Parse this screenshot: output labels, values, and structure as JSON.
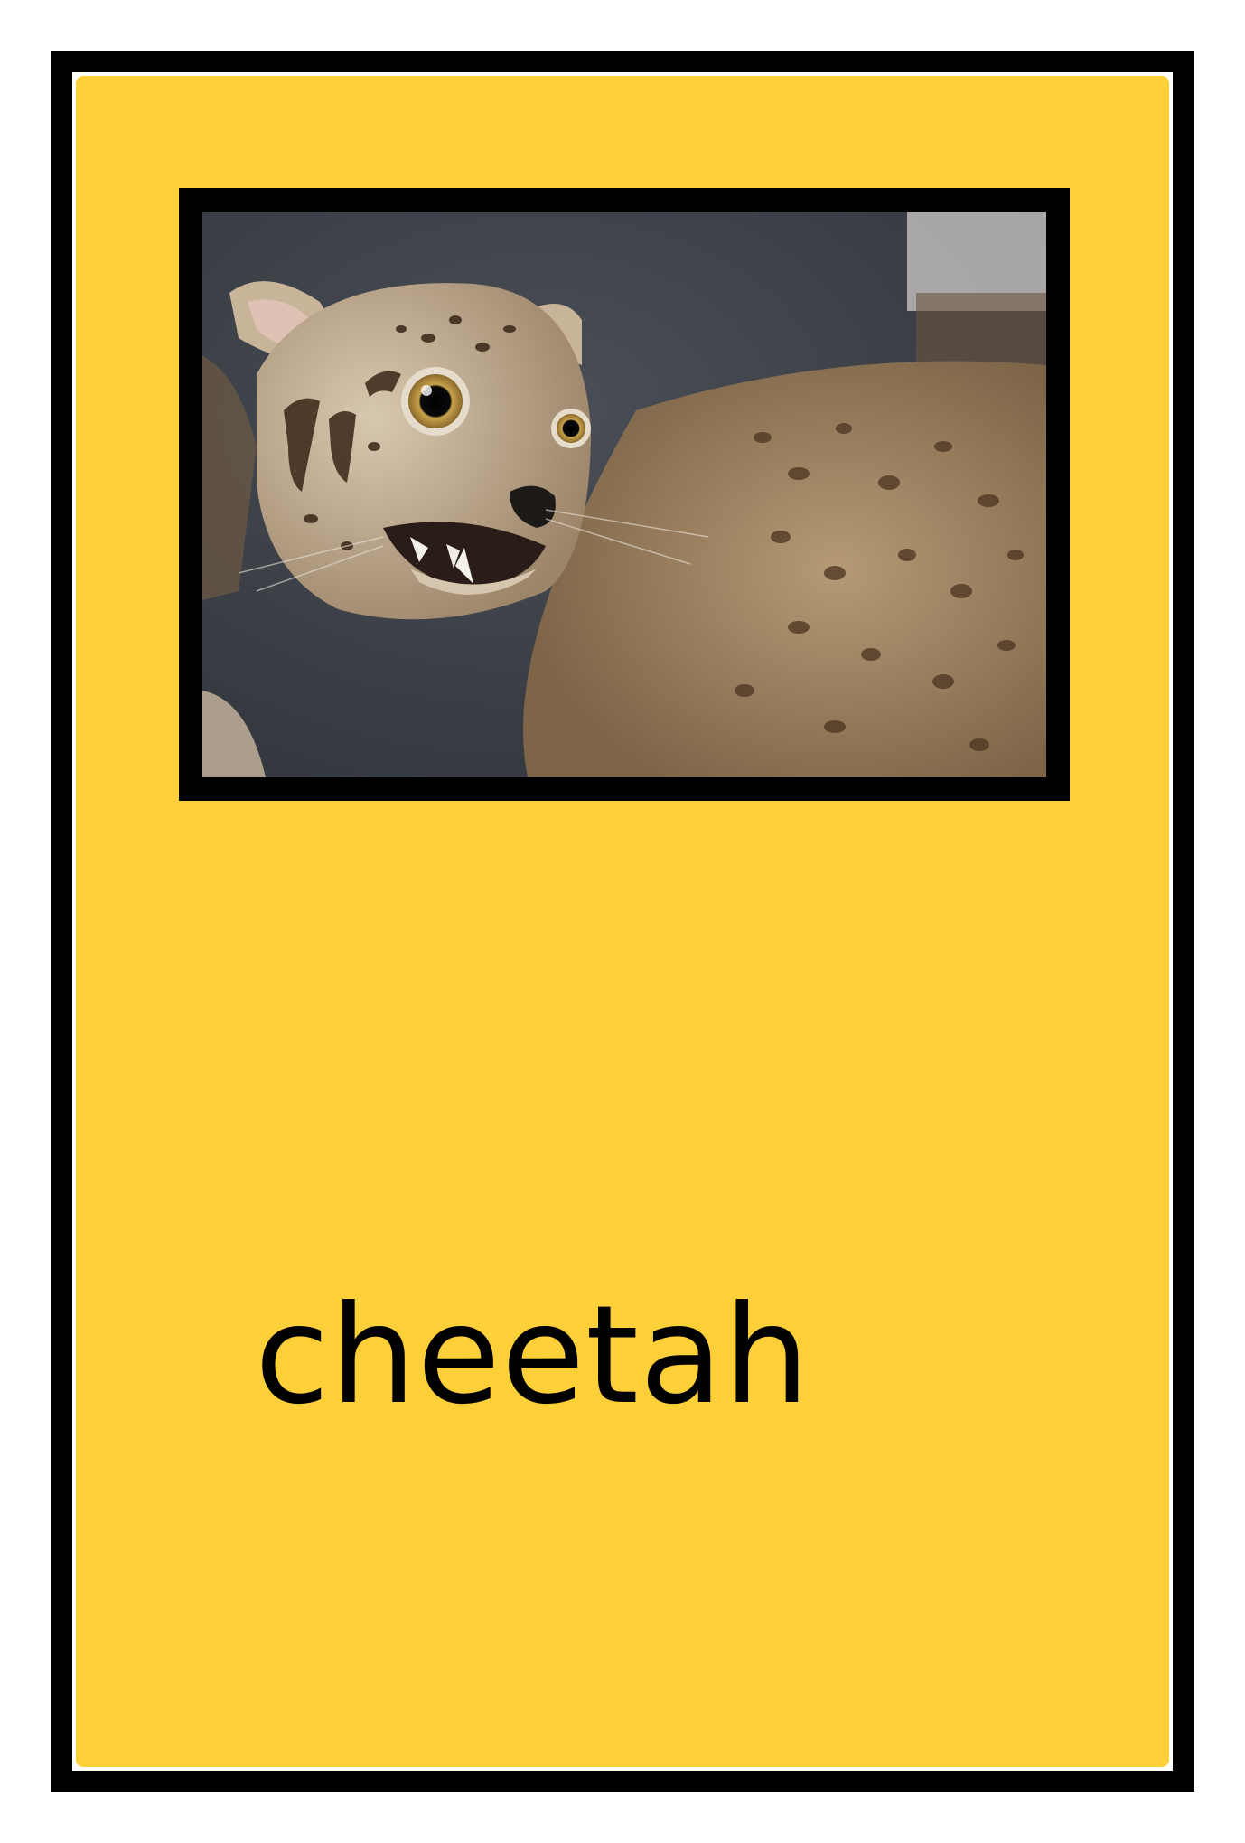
{
  "card": {
    "word": "cheetah",
    "picture": "photo-of-spotted-cat"
  },
  "colors": {
    "card_background": "#fdd03a",
    "border": "#000000",
    "page_background": "#ffffff",
    "text": "#000000"
  }
}
